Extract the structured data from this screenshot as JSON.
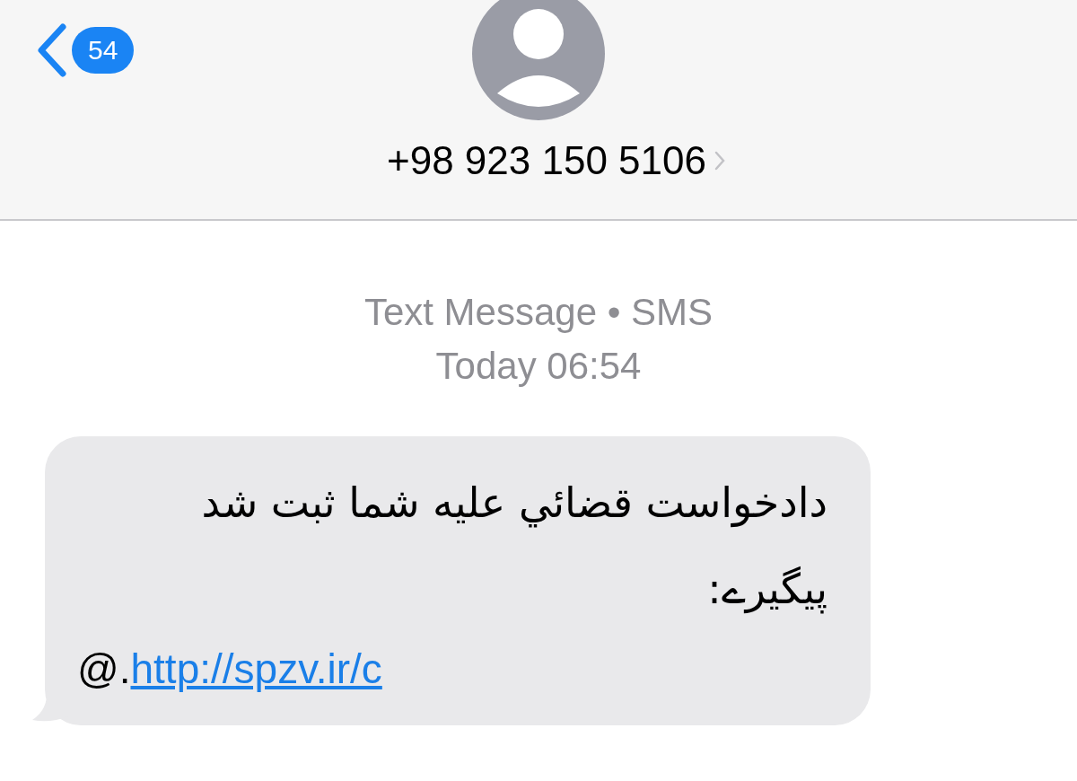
{
  "header": {
    "back_badge": "54",
    "contact": "+98 923 150 5106"
  },
  "meta": {
    "service": "Text Message • SMS",
    "time": "Today 06:54"
  },
  "messages": [
    {
      "kind": "incoming",
      "text": "دادخواست قضائي عليه شما ثبت شد پيگيرے:",
      "link_prefix": "@.",
      "link": "http://spzv.ir/c"
    }
  ]
}
